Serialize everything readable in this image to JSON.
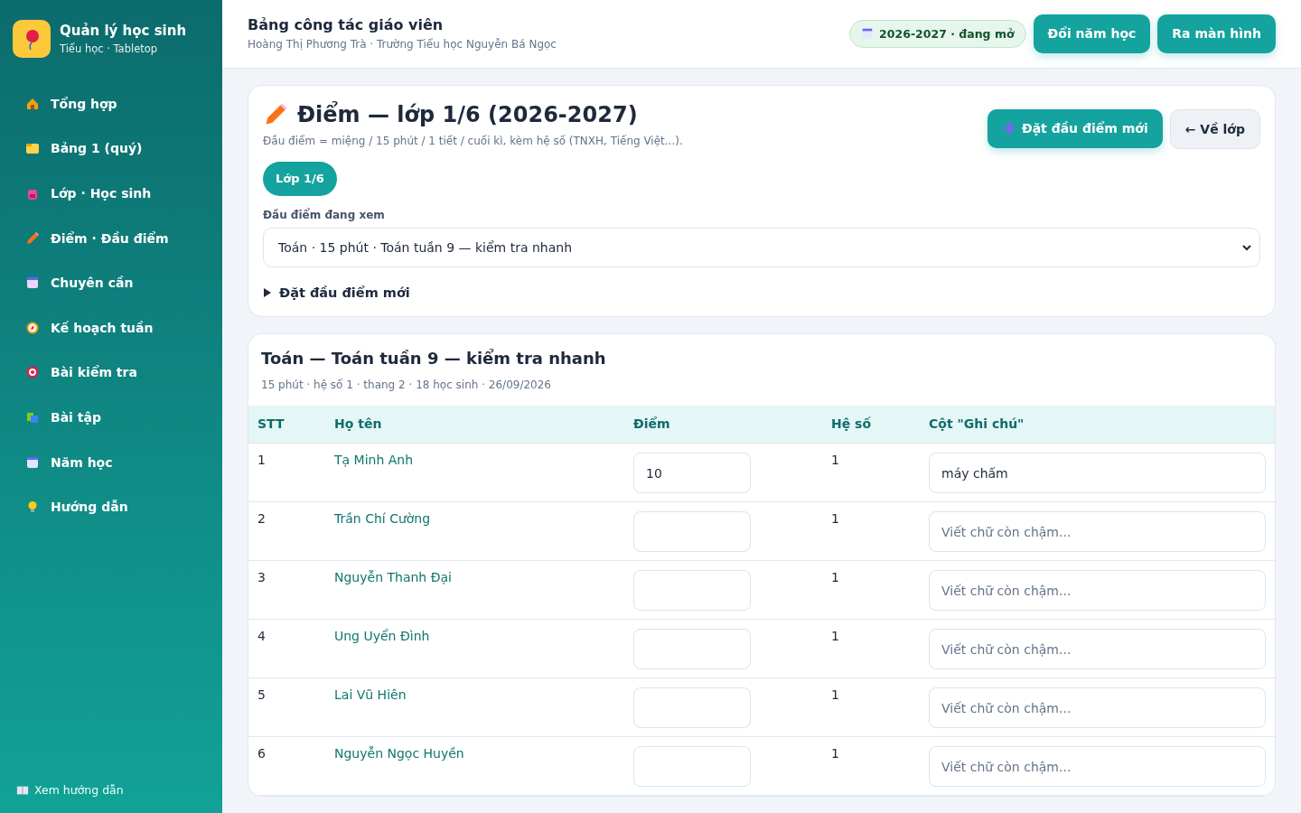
{
  "sidebar": {
    "app_title": "Quản lý học sinh",
    "app_subtitle": "Tiểu học · Tabletop",
    "items": [
      {
        "label": "Tổng hợp"
      },
      {
        "label": "Bảng 1 (quý)"
      },
      {
        "label": "Lớp · Học sinh"
      },
      {
        "label": "Điểm · Đầu điểm"
      },
      {
        "label": "Chuyên cần"
      },
      {
        "label": "Kế hoạch tuần"
      },
      {
        "label": "Bài kiểm tra"
      },
      {
        "label": "Bài tập"
      },
      {
        "label": "Năm học"
      },
      {
        "label": "Hướng dẫn"
      }
    ],
    "footer_link": "Xem hướng dẫn"
  },
  "header": {
    "title": "Bảng công tác giáo viên",
    "subtitle": "Hoàng Thị Phương Trà · Trường Tiểu học Nguyễn Bá Ngọc",
    "year_badge": "2026-2027 · đang mở",
    "buttons": [
      "Đổi năm học",
      "Ra màn hình"
    ]
  },
  "grade_card": {
    "title": "Điểm — lớp 1/6 (2026-2027)",
    "description": "Đầu điểm = miệng / 15 phút / 1 tiết / cuối kì, kèm hệ số (TNXH, Tiếng Việt...).",
    "new_button": "Đặt đầu điểm mới",
    "back_button": "← Về lớp",
    "class_chips": [
      {
        "label": "Lớp 1/6",
        "selected": true
      }
    ],
    "select_label": "Đầu điểm đang xem",
    "select_value": "Toán · 15 phút · Toán tuần 9 — kiểm tra nhanh",
    "disclosure": {
      "label": "Đặt đầu điểm mới",
      "expanded": false
    }
  },
  "score_table": {
    "title": "Toán — Toán tuần 9 — kiểm tra nhanh",
    "meta": "15 phút · hệ số 1 · thang 2 · 18 học sinh · 26/09/2026",
    "columns": [
      "STT",
      "Họ tên",
      "Điểm",
      "Hệ số",
      "Cột \"Ghi chú\""
    ],
    "rows": [
      {
        "stt": "1",
        "name": "Tạ Minh Anh",
        "score": "10",
        "weight": "1",
        "note": "máy chấm"
      },
      {
        "stt": "2",
        "name": "Trần Chí Cường",
        "weight": "1",
        "note_placeholder": "Viết chữ còn chậm..."
      },
      {
        "stt": "3",
        "name": "Nguyễn Thanh Đại",
        "weight": "1",
        "note_placeholder": "Viết chữ còn chậm..."
      },
      {
        "stt": "4",
        "name": "Ung Uyển Đình",
        "weight": "1",
        "note_placeholder": "Viết chữ còn chậm..."
      },
      {
        "stt": "5",
        "name": "Lai Vũ Hiên",
        "weight": "1",
        "note_placeholder": "Viết chữ còn chậm..."
      },
      {
        "stt": "6",
        "name": "Nguyễn Ngọc Huyền",
        "weight": "1",
        "note_placeholder": "Viết chữ còn chậm..."
      }
    ]
  }
}
